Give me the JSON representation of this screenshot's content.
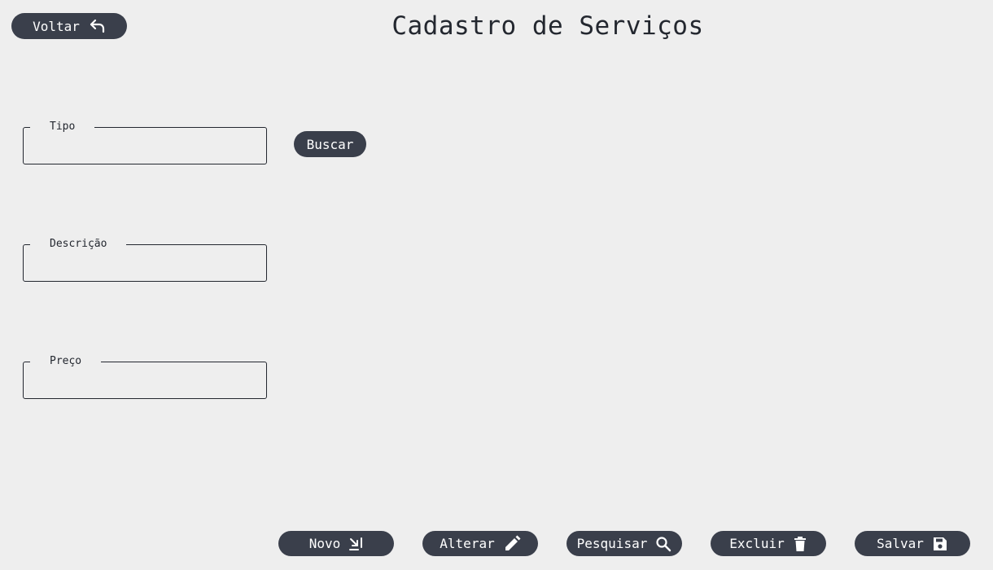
{
  "header": {
    "back_label": "Voltar",
    "title": "Cadastro de Serviços"
  },
  "form": {
    "tipo": {
      "label": "Tipo",
      "value": ""
    },
    "descricao": {
      "label": "Descrição",
      "value": ""
    },
    "preco": {
      "label": "Preço",
      "value": ""
    },
    "search_label": "Buscar"
  },
  "actions": [
    {
      "label": "Novo",
      "icon": "new-icon"
    },
    {
      "label": "Alterar",
      "icon": "pencil-icon"
    },
    {
      "label": "Pesquisar",
      "icon": "search-icon"
    },
    {
      "label": "Excluir",
      "icon": "trash-icon"
    },
    {
      "label": "Salvar",
      "icon": "save-icon"
    }
  ],
  "colors": {
    "background": "#eeeeee",
    "button": "#3a3f4b",
    "button_text": "#ffffff",
    "text": "#23272f"
  }
}
